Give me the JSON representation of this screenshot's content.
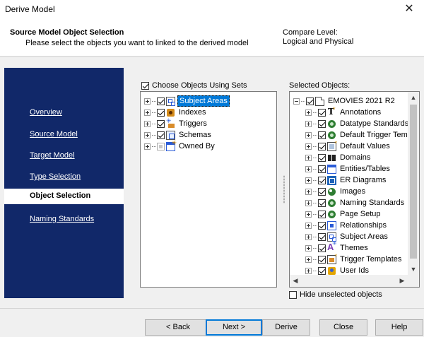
{
  "window": {
    "title": "Derive Model",
    "close_glyph": "✕"
  },
  "header": {
    "title": "Source Model Object Selection",
    "subtitle": "Please select the objects you want to linked  to the derived model",
    "compare_level_label": "Compare Level:",
    "compare_level_value": "Logical and Physical"
  },
  "nav": {
    "items": [
      "Overview",
      "Source Model",
      "Target Model",
      "Type Selection",
      "Object Selection",
      "Naming Standards"
    ],
    "active": "Object Selection"
  },
  "left": {
    "choose_sets_label": "Choose Objects Using Sets",
    "choose_sets_checked": true,
    "items": [
      {
        "label": "Subject Areas",
        "icon": "subject-area-icon",
        "checked": true,
        "selected": true
      },
      {
        "label": "Indexes",
        "icon": "index-icon",
        "checked": true
      },
      {
        "label": "Triggers",
        "icon": "trigger-icon",
        "checked": true
      },
      {
        "label": "Schemas",
        "icon": "schema-icon",
        "checked": true
      },
      {
        "label": "Owned By",
        "icon": "owned-by-icon",
        "checked": false
      }
    ]
  },
  "right": {
    "label": "Selected Objects:",
    "root": {
      "label": "EMOVIES 2021 R2",
      "icon": "document-icon",
      "checked": true
    },
    "items": [
      {
        "label": "Annotations",
        "icon": "annotation-icon"
      },
      {
        "label": "Datatype Standards",
        "icon": "datatype-standards-icon"
      },
      {
        "label": "Default Trigger Temp",
        "icon": "default-trigger-template-icon"
      },
      {
        "label": "Default Values",
        "icon": "default-values-icon"
      },
      {
        "label": "Domains",
        "icon": "domain-icon"
      },
      {
        "label": "Entities/Tables",
        "icon": "entity-table-icon"
      },
      {
        "label": "ER Diagrams",
        "icon": "er-diagram-icon"
      },
      {
        "label": "Images",
        "icon": "image-icon"
      },
      {
        "label": "Naming Standards",
        "icon": "naming-standards-icon"
      },
      {
        "label": "Page Setup",
        "icon": "page-setup-icon"
      },
      {
        "label": "Relationships",
        "icon": "relationship-icon"
      },
      {
        "label": "Subject Areas",
        "icon": "subject-area-icon"
      },
      {
        "label": "Themes",
        "icon": "theme-icon"
      },
      {
        "label": "Trigger Templates",
        "icon": "trigger-template-icon"
      },
      {
        "label": "User Ids",
        "icon": "user-id-icon"
      }
    ],
    "hide_unselected_label": "Hide unselected objects"
  },
  "buttons": {
    "back": "< Back",
    "next": "Next >",
    "derive": "Derive",
    "close": "Close",
    "help": "Help"
  },
  "colors": {
    "nav_bg": "#112869",
    "selection": "#0078d7"
  }
}
